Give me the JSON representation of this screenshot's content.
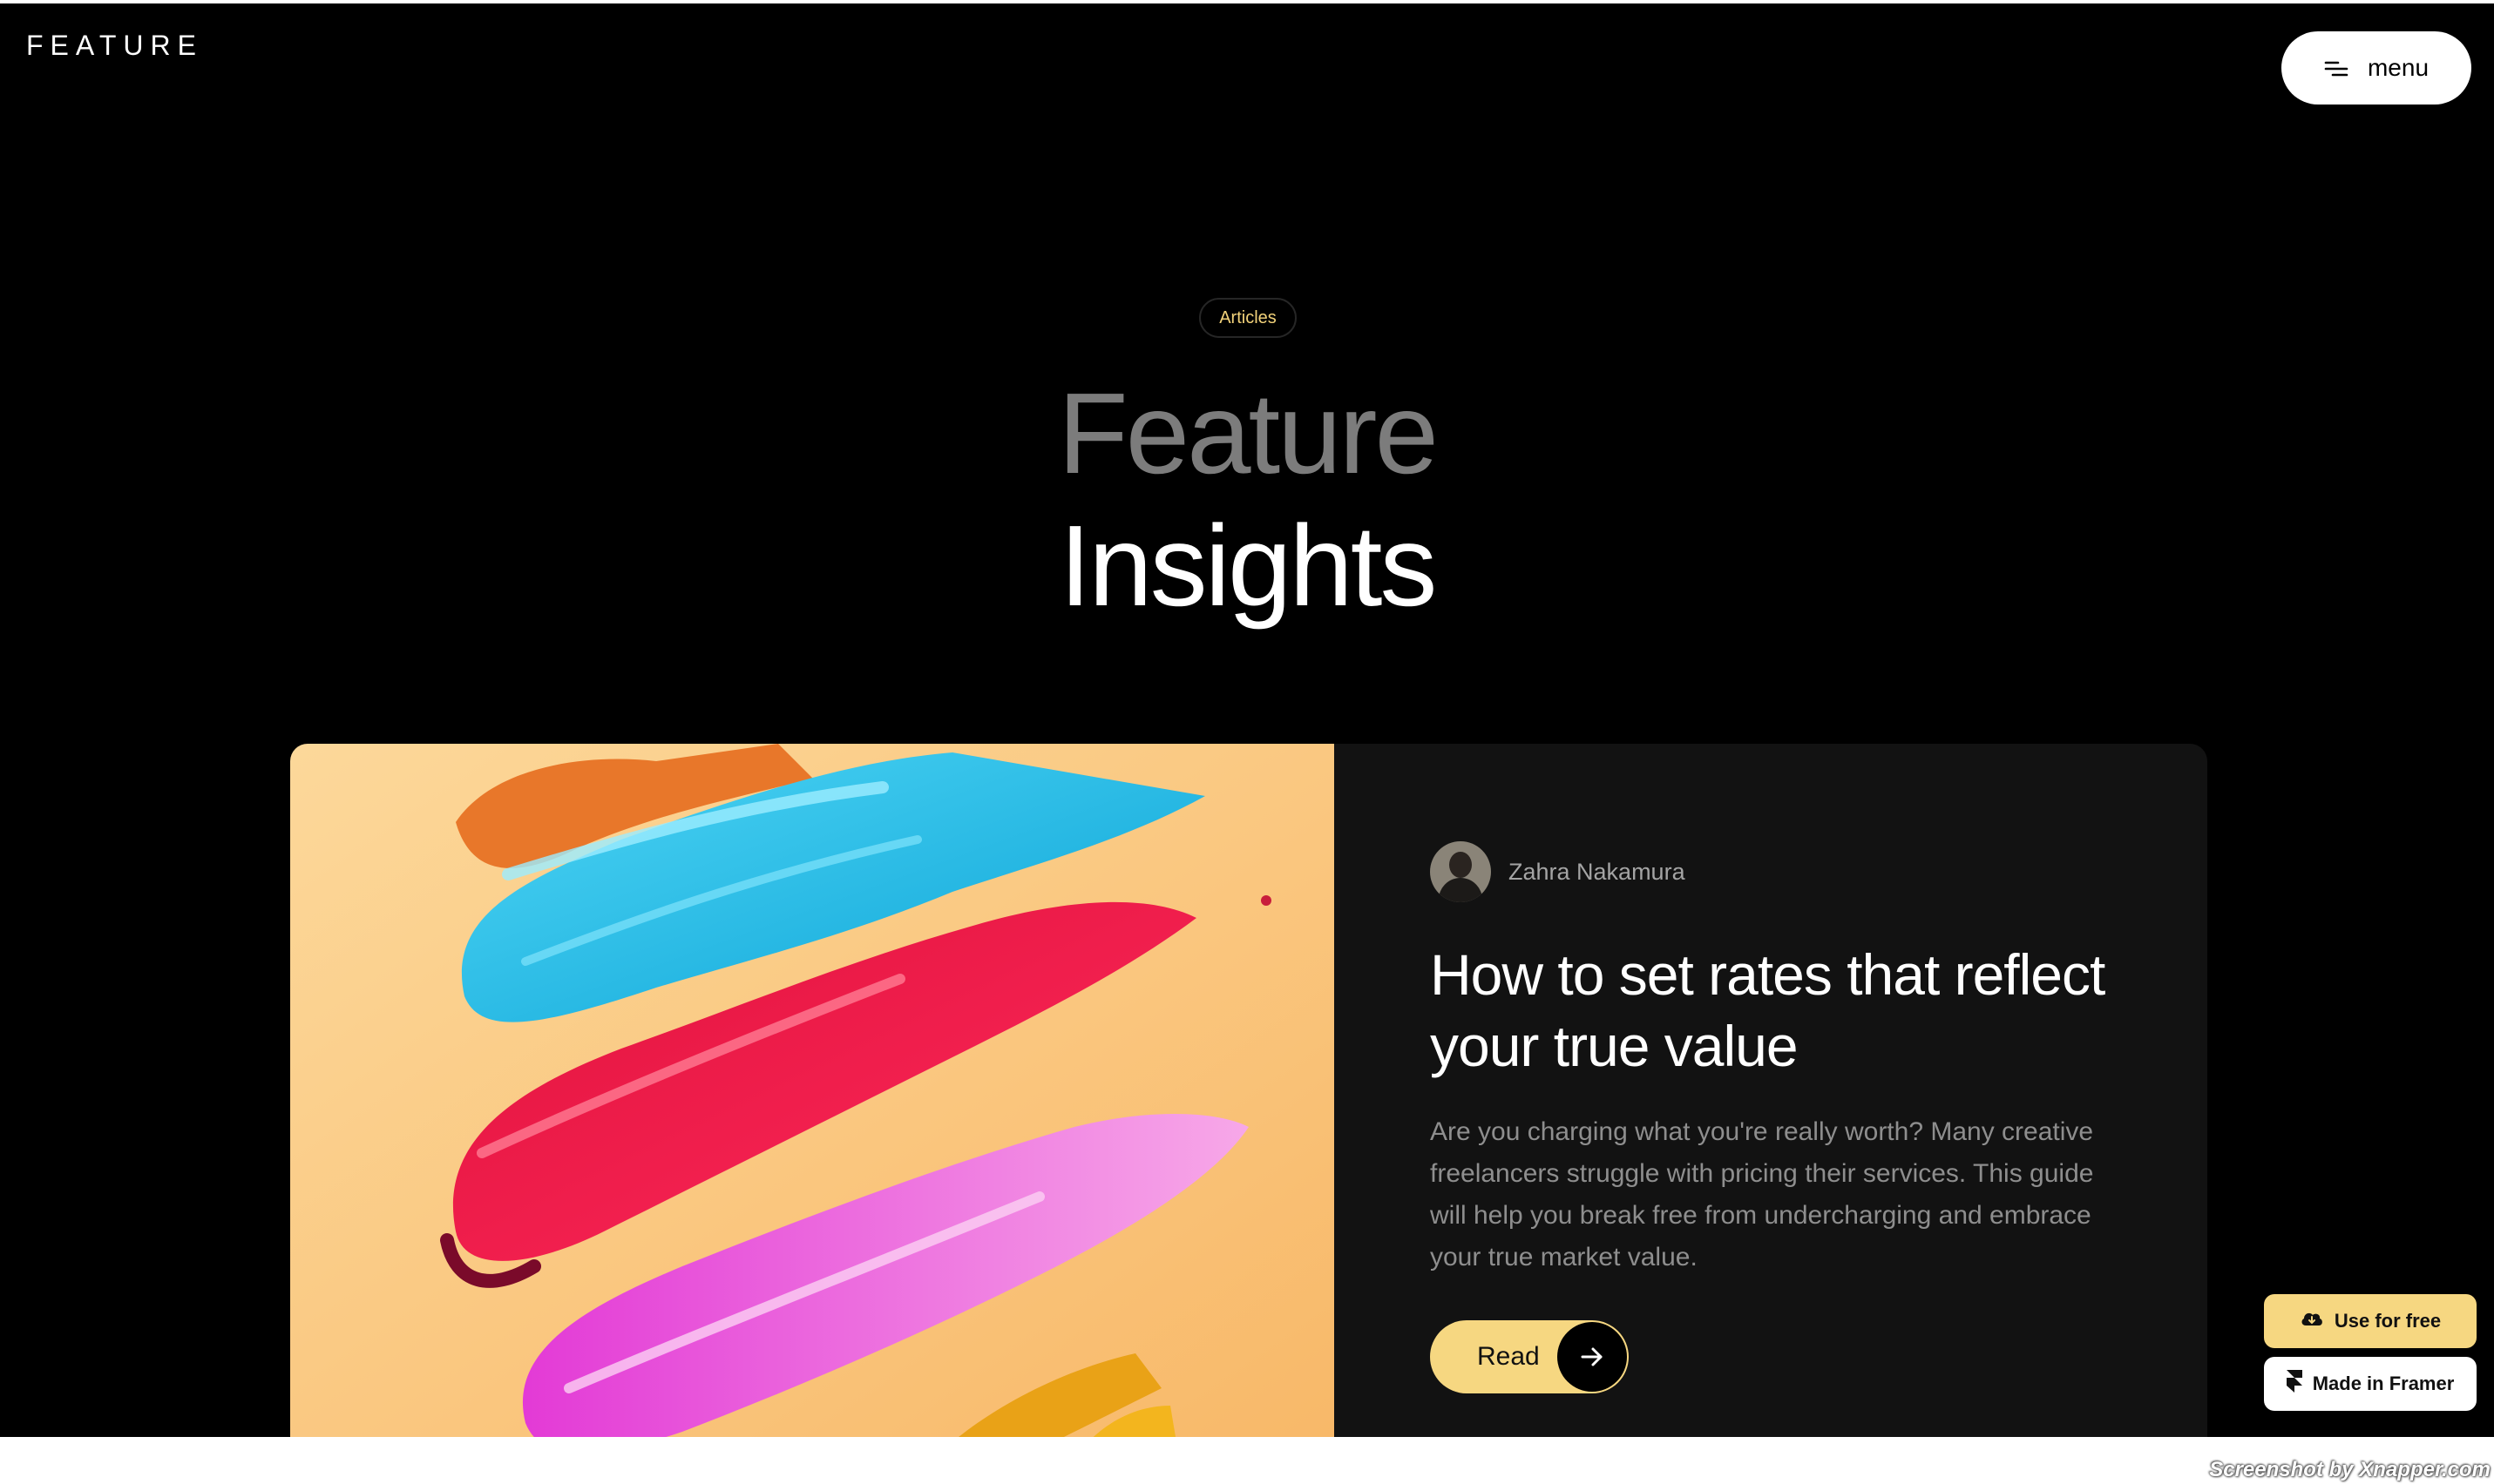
{
  "header": {
    "logo": "FEATURE",
    "menu_label": "menu",
    "menu_icon": "hamburger-icon"
  },
  "hero": {
    "badge": "Articles",
    "title_line1": "Feature",
    "title_line2": "Insights"
  },
  "article": {
    "image_desc_icon": "paint-strokes-image",
    "author": "Zahra Nakamura",
    "title": "How to set rates that reflect your true value",
    "description": "Are you charging what you're really worth? Many creative freelancers struggle with pricing their services. This guide will help you break free from undercharging and embrace your true market value.",
    "cta_label": "Read",
    "cta_icon": "arrow-right-icon"
  },
  "badges": {
    "use_free": "Use for free",
    "use_free_icon": "cloud-icon",
    "made_in": "Made in Framer",
    "made_in_icon": "framer-icon"
  },
  "watermark": "Screenshot by Xnapper.com",
  "colors": {
    "background": "#000000",
    "card": "#121212",
    "accent": "#f6d781",
    "muted_title": "#7c7c7c"
  }
}
